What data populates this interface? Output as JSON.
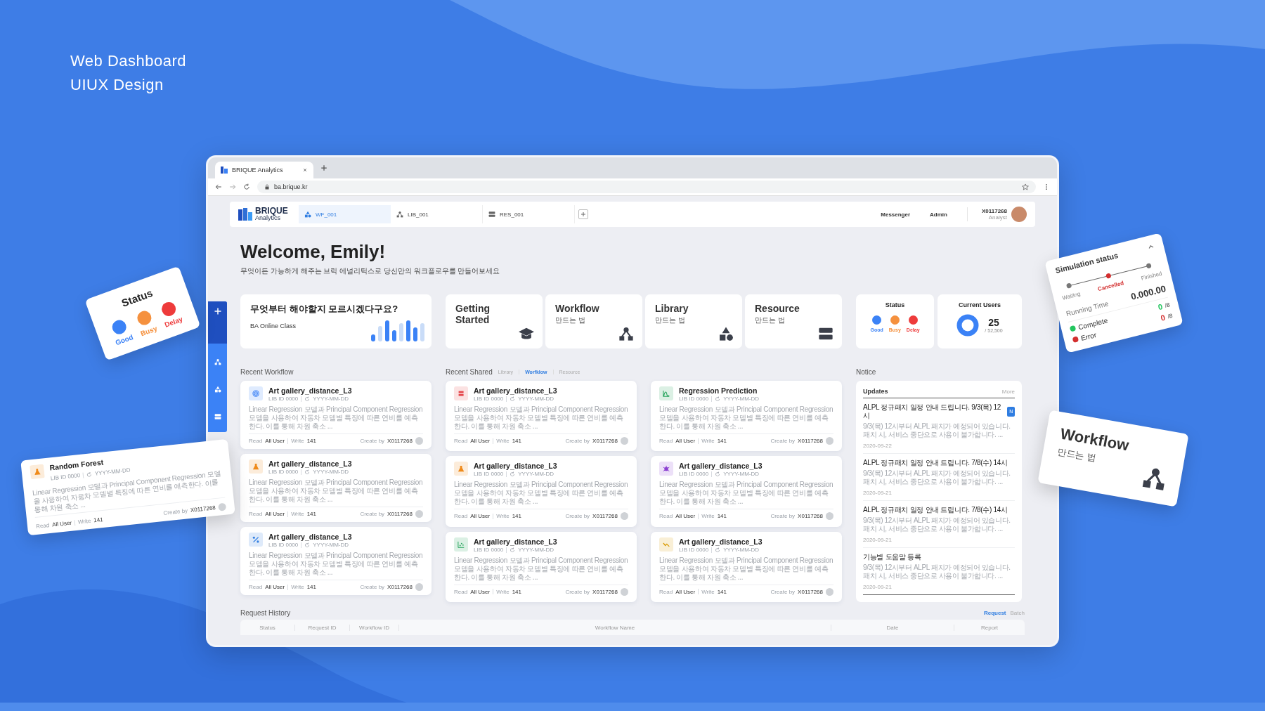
{
  "page_heading": [
    "Web Dashboard",
    "UIUX Design"
  ],
  "browser": {
    "tab_title": "BRIQUE Analytics",
    "url": "ba.brique.kr"
  },
  "header": {
    "logo_name": "BRIQUE",
    "logo_sub": "Analytics",
    "tabs": [
      {
        "label": "WF_001",
        "kind": "shapes",
        "selected": true
      },
      {
        "label": "LIB_001",
        "kind": "network",
        "selected": false
      },
      {
        "label": "RES_001",
        "kind": "server",
        "selected": false
      }
    ],
    "links": [
      "Messenger",
      "Admin"
    ],
    "user": {
      "id": "X0117268",
      "role": "Analyst"
    }
  },
  "sidebar": {
    "items": [
      {
        "kind": "plus"
      },
      {
        "kind": "network"
      },
      {
        "kind": "shapes"
      },
      {
        "kind": "server"
      }
    ]
  },
  "welcome": {
    "title": "Welcome, Emily!",
    "subtitle": "무엇이든 가능하게 해주는 브릭 에널리틱스로 당신만의 워크플로우를 만들어보세요"
  },
  "class_card": {
    "title": "무엇부터 해야할지 모르시겠다구요?",
    "label": "BA Online Class"
  },
  "guides": [
    {
      "title": "Getting Started",
      "kind": "cap"
    },
    {
      "title": "Workflow",
      "subtitle": "만드는 법",
      "kind": "network"
    },
    {
      "title": "Library",
      "subtitle": "만드는 법",
      "kind": "shapes"
    },
    {
      "title": "Resource",
      "subtitle": "만드는 법",
      "kind": "server"
    }
  ],
  "status": {
    "title": "Status",
    "dots": [
      {
        "label": "Good",
        "color": "#3b82f6"
      },
      {
        "label": "Busy",
        "color": "#f5913e"
      },
      {
        "label": "Delay",
        "color": "#ee3b3b"
      }
    ]
  },
  "users": {
    "title": "Current Users",
    "count": "25",
    "total": "/ 52,500"
  },
  "recent_workflow": {
    "title": "Recent Workflow",
    "cards": [
      {
        "title": "Art gallery_distance_L3",
        "id": "LIB ID 0000",
        "date": "YYYY-MM-DD",
        "description": "Linear Regression 모델과 Principal Component Regression 모델을 사용하여 자동차 모델별 특징에 따른 연비를 예측한다. 이를 통해 차원 축소 ...",
        "read_label": "Read",
        "read": "All User",
        "write_label": "Write",
        "write": "141",
        "creator_label": "Create by",
        "creator": "X0117268",
        "kind": "target"
      },
      {
        "title": "Art gallery_distance_L3",
        "id": "LIB ID 0000",
        "date": "YYYY-MM-DD",
        "description": "Linear Regression 모델과 Principal Component Regression 모델을 사용하여 자동차 모델별 특징에 따른 연비를 예측한다. 이를 통해 차원 축소 ...",
        "read_label": "Read",
        "read": "All User",
        "write_label": "Write",
        "write": "141",
        "creator_label": "Create by",
        "creator": "X0117268",
        "kind": "flask"
      },
      {
        "title": "Art gallery_distance_L3",
        "id": "LIB ID 0000",
        "date": "YYYY-MM-DD",
        "description": "Linear Regression 모델과 Principal Component Regression 모델을 사용하여 자동차 모델별 특징에 따른 연비를 예측한다. 이를 통해 차원 축소 ...",
        "read_label": "Read",
        "read": "All User",
        "write_label": "Write",
        "write": "141",
        "creator_label": "Create by",
        "creator": "X0117268",
        "kind": "percent"
      }
    ]
  },
  "recent_shared": {
    "title": "Recent Shared",
    "filters": [
      {
        "label": "Library",
        "selected": false
      },
      {
        "label": "Worfklow",
        "selected": true
      },
      {
        "label": "Resource",
        "selected": false
      }
    ],
    "cards": [
      {
        "title": "Art gallery_distance_L3",
        "id": "LIB ID 0000",
        "date": "YYYY-MM-DD",
        "description": "Linear Regression 모델과 Principal Component Regression 모델을 사용하여 자동차 모델별 특징에 따른 연비를 예측한다. 이를 통해 차원 축소 ...",
        "read_label": "Read",
        "read": "All User",
        "write_label": "Write",
        "write": "141",
        "creator_label": "Create by",
        "creator": "X0117268",
        "kind": "stack"
      },
      {
        "title": "Regression Prediction",
        "id": "LIB ID 0000",
        "date": "YYYY-MM-DD",
        "description": "Linear Regression 모델과 Principal Component Regression 모델을 사용하여 자동차 모델별 특징에 따른 연비를 예측한다. 이를 통해 차원 축소 ...",
        "read_label": "Read",
        "read": "All User",
        "write_label": "Write",
        "write": "141",
        "creator_label": "Create by",
        "creator": "X0117268",
        "kind": "curve"
      },
      {
        "title": "Art gallery_distance_L3",
        "id": "LIB ID 0000",
        "date": "YYYY-MM-DD",
        "description": "Linear Regression 모델과 Principal Component Regression 모델을 사용하여 자동차 모델별 특징에 따른 연비를 예측한다. 이를 통해 차원 축소 ...",
        "read_label": "Read",
        "read": "All User",
        "write_label": "Write",
        "write": "141",
        "creator_label": "Create by",
        "creator": "X0117268",
        "kind": "flask"
      },
      {
        "title": "Art gallery_distance_L3",
        "id": "LIB ID 0000",
        "date": "YYYY-MM-DD",
        "description": "Linear Regression 모델과 Principal Component Regression 모델을 사용하여 자동차 모델별 특징에 따른 연비를 예측한다. 이를 통해 차원 축소 ...",
        "read_label": "Read",
        "read": "All User",
        "write_label": "Write",
        "write": "141",
        "creator_label": "Create by",
        "creator": "X0117268",
        "kind": "bug"
      },
      {
        "title": "Art gallery_distance_L3",
        "id": "LIB ID 0000",
        "date": "YYYY-MM-DD",
        "description": "Linear Regression 모델과 Principal Component Regression 모델을 사용하여 자동차 모델별 특징에 따른 연비를 예측한다. 이를 통해 차원 축소 ...",
        "read_label": "Read",
        "read": "All User",
        "write_label": "Write",
        "write": "141",
        "creator_label": "Create by",
        "creator": "X0117268",
        "kind": "scatter"
      },
      {
        "title": "Art gallery_distance_L3",
        "id": "LIB ID 0000",
        "date": "YYYY-MM-DD",
        "description": "Linear Regression 모델과 Principal Component Regression 모델을 사용하여 자동차 모델별 특징에 따른 연비를 예측한다. 이를 통해 차원 축소 ...",
        "read_label": "Read",
        "read": "All User",
        "write_label": "Write",
        "write": "141",
        "creator_label": "Create by",
        "creator": "X0117268",
        "kind": "wave"
      }
    ]
  },
  "notice": {
    "title": "Notice",
    "panel_title": "Updates",
    "more": "More",
    "items": [
      {
        "title": "ALPL 정규패치 일정 안내 드립니다. 9/3(목) 12시",
        "new": true,
        "badge": "N",
        "body": "9/3(목) 12시부터 ALPL 패치가 예정되어 있습니다. 패치 시, 서비스 중단으로 사용이 불가합니다. ...",
        "date": "2020-09-22"
      },
      {
        "title": "ALPL 정규패치 일정 안내 드립니다. 7/8(수) 14시",
        "new": false,
        "body": "9/3(목) 12시부터 ALPL 패치가 예정되어 있습니다. 패치 시, 서비스 중단으로 사용이 불가합니다. ...",
        "date": "2020-09-21"
      },
      {
        "title": "ALPL 정규패치 일정 안내 드립니다. 7/8(수) 14시",
        "new": false,
        "body": "9/3(목) 12시부터 ALPL 패치가 예정되어 있습니다. 패치 시, 서비스 중단으로 사용이 불가합니다. ...",
        "date": "2020-09-21"
      },
      {
        "title": "기능별 도움말 등록",
        "new": false,
        "body": "9/3(목) 12시부터 ALPL 패치가 예정되어 있습니다. 패치 시, 서비스 중단으로 사용이 불가합니다. ...",
        "date": "2020-09-21"
      }
    ]
  },
  "request_history": {
    "title": "Request History",
    "tabs": [
      {
        "label": "Request",
        "selected": true
      },
      {
        "label": "Batch",
        "selected": false
      }
    ],
    "columns": [
      "Status",
      "Request ID",
      "Workflow ID",
      "Workflow Name",
      "Date",
      "Report"
    ]
  },
  "floating": {
    "status_card": {
      "title": "Status",
      "dots": [
        {
          "label": "Good",
          "color": "#3b82f6"
        },
        {
          "label": "Busy",
          "color": "#f5913e"
        },
        {
          "label": "Delay",
          "color": "#ee3b3b"
        }
      ]
    },
    "forest_card": {
      "title": "Random Forest",
      "id": "LIB ID 0000",
      "date": "YYYY-MM-DD",
      "description": "Linear Regression 모델과 Principal Component Regression 모델을 사용하여 자동차 모델별 특징에 따른 연비를 예측한다. 이를 통해 차원 축소 ...",
      "read_label": "Read",
      "read": "All User",
      "write_label": "Write",
      "write": "141",
      "creator_label": "Create by",
      "creator": "X0117268",
      "kind": "flask"
    },
    "simulation": {
      "title": "Simulation status",
      "steps": [
        {
          "label": "Waiting",
          "selected": false
        },
        {
          "label": "Cancelled",
          "selected": true
        },
        {
          "label": "Finished",
          "selected": false
        }
      ],
      "running_label": "Running Time",
      "running_time": "0.000.00",
      "results": [
        {
          "label": "Complete",
          "count": "0",
          "total": "/8",
          "color": "#22c55e"
        },
        {
          "label": "Error",
          "count": "0",
          "total": "/8",
          "color": "#d32f2f"
        }
      ]
    },
    "guide_card": {
      "title": "Workflow",
      "subtitle": "만드는 법",
      "kind": "network"
    }
  }
}
